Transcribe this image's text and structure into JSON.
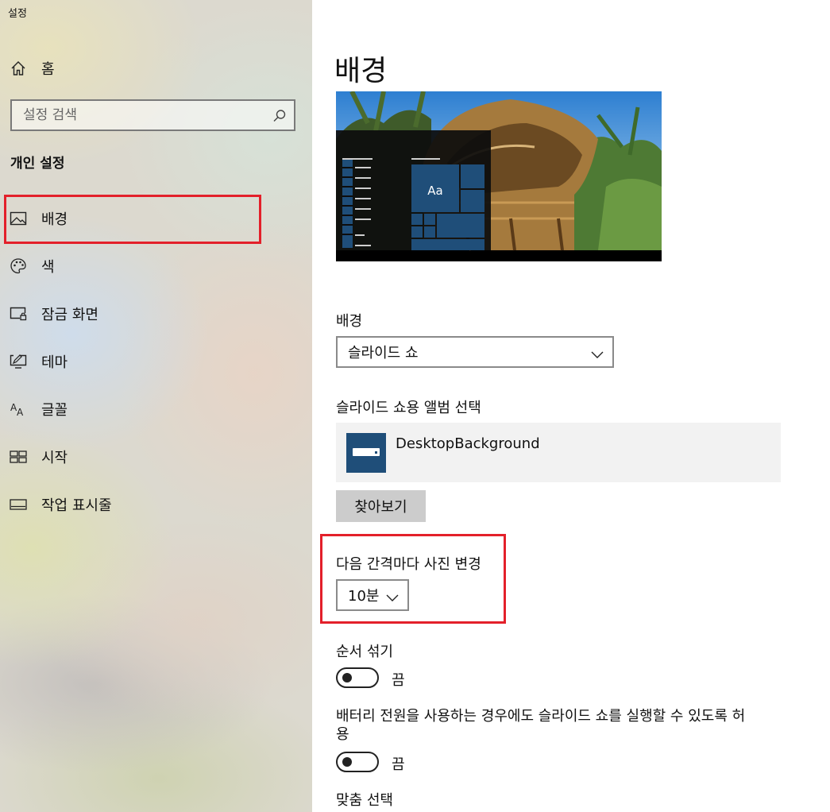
{
  "app": {
    "title": "설정"
  },
  "sidebar": {
    "home_label": "홈",
    "search_placeholder": "설정 검색",
    "section_title": "개인 설정",
    "items": [
      {
        "label": "배경",
        "icon": "picture-icon",
        "selected": true
      },
      {
        "label": "색",
        "icon": "palette-icon"
      },
      {
        "label": "잠금 화면",
        "icon": "lock-screen-icon"
      },
      {
        "label": "테마",
        "icon": "theme-icon"
      },
      {
        "label": "글꼴",
        "icon": "font-icon"
      },
      {
        "label": "시작",
        "icon": "start-icon"
      },
      {
        "label": "작업 표시줄",
        "icon": "taskbar-icon"
      }
    ]
  },
  "main": {
    "title": "배경",
    "preview": {
      "tile_text": "Aa"
    },
    "background_label": "배경",
    "background_value": "슬라이드 쇼",
    "album_label": "슬라이드 쇼용 앨범 선택",
    "album_name": "DesktopBackground",
    "browse_button": "찾아보기",
    "interval_label": "다음 간격마다 사진 변경",
    "interval_value": "10분",
    "shuffle_label": "순서 섞기",
    "shuffle_state": "끔",
    "shuffle_on": false,
    "battery_label_line1": "배터리 전원을 사용하는 경우에도 슬라이드 쇼를 실행할 수 있도록 허",
    "battery_label_line2": "용",
    "battery_state": "끔",
    "battery_on": false,
    "fit_label": "맞춤 선택"
  },
  "colors": {
    "accent": "#1f4e79",
    "highlight_box": "#e3202a",
    "button_bg": "#cccccc",
    "card_bg": "#f2f2f2"
  }
}
